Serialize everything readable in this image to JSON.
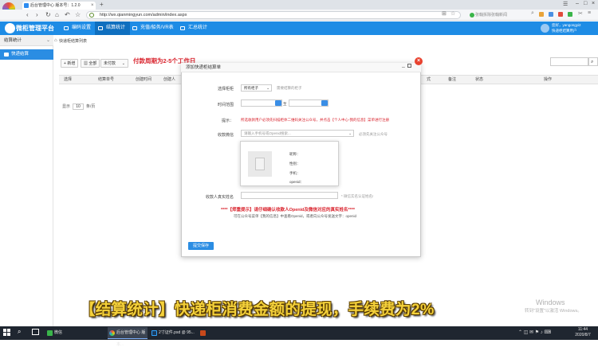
{
  "browser": {
    "tab_title": "后台管理中心 版本号：1.2.0",
    "url": "http://wx.qianmingyun.com/admin/index.aspx",
    "search_placeholder": "张翰拆除张翰新闻"
  },
  "app": {
    "logo_text": "微柜管理平台",
    "nav": [
      "编码设置",
      "结算统计",
      "充值/船务/VR表",
      "汇总统计"
    ],
    "active_nav": 1,
    "user_line1": "您好，yangongyi2",
    "user_line2": "快递柜结算用户"
  },
  "sidebar": {
    "header": "结算统计",
    "items": [
      "快递结算"
    ]
  },
  "page": {
    "breadcrumb": "快递柜结算列表",
    "buttons": [
      "新增",
      "全部",
      "未付款"
    ],
    "hint": "付款周期为2-5个工作日",
    "columns": [
      "选择",
      "结算单号",
      "创建时间",
      "创建人",
      "式",
      "备注",
      "状态",
      "操作"
    ],
    "pager_show": "显示",
    "pager_size": "10",
    "pager_unit": "条/页"
  },
  "modal": {
    "title": "添加快递柜结算单",
    "select_cabinet_label": "选择柜柜",
    "select_cabinet_value": "所有柜子",
    "select_cabinet_note": "需要结算的柜子",
    "time_range_label": "时间范围",
    "time_range_sep": "至",
    "tip_label": "提示：",
    "tip_text": "所选收款用户必须先扫描柜体二维码关注公众号，并点击【个人中心-我的信息】菜单进行注册",
    "payee_label": "收款微信",
    "payee_placeholder": "请输入手机号或Openid搜索...",
    "payee_note": "必须先关注公众号",
    "popup_fields": [
      "昵称：",
      "性别：",
      "手机：",
      "openid："
    ],
    "realname_label": "收款人真实姓名",
    "realname_note": "* 微信实名认证姓名!",
    "warning": "****【郑重提示】请仔细确认收款人Openid及微信对应的真实姓名****",
    "subwarning": "可在公众号菜单【我的信息】中查看Openid，或者向公众号发送文字：openid",
    "submit": "提交保存"
  },
  "caption": "【结算统计】快递柜消费金额的提现，手续费为2%",
  "watermark": {
    "line1": "Windows",
    "line2": "转到\"设置\"以激活 Windows。"
  },
  "taskbar": {
    "items": [
      "微信",
      "后台管理中心 版本...",
      "2寸证件.psd @ 95...",
      ""
    ],
    "time": "11:44",
    "date": "2020/8/7"
  },
  "colors": {
    "brand": "#1e8ce5",
    "accent": "#2b8de3",
    "alert": "#d9232d",
    "caption": "#f4d13a"
  }
}
